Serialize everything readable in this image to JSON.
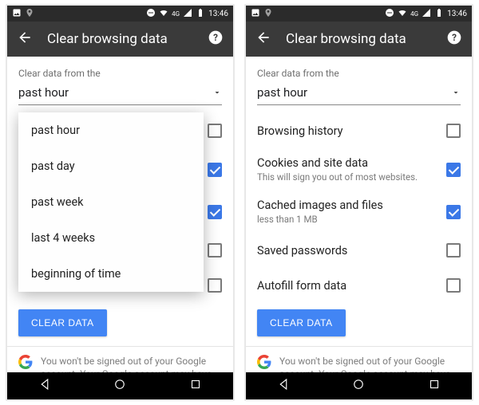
{
  "statusbar": {
    "time": "13:46",
    "net_label": "4G"
  },
  "appbar": {
    "title": "Clear browsing data"
  },
  "section_label": "Clear data from the",
  "time_range_value": "past hour",
  "dropdown": {
    "options": [
      "past hour",
      "past day",
      "past week",
      "last 4 weeks",
      "beginning of time"
    ]
  },
  "rows": {
    "browsing": {
      "label": "Browsing history",
      "checked": false
    },
    "cookies": {
      "label": "Cookies and site data",
      "sub": "This will sign you out of most websites.",
      "checked": true
    },
    "cache": {
      "label": "Cached images and files",
      "sub": "less than 1 MB",
      "checked": true
    },
    "passwords": {
      "label": "Saved passwords",
      "checked": false
    },
    "autofill": {
      "label": "Autofill form data",
      "checked": false
    }
  },
  "clear_button": "CLEAR DATA",
  "footer_text": "You won't be signed out of your Google account. Your Google account may have other forms of browsing history at"
}
